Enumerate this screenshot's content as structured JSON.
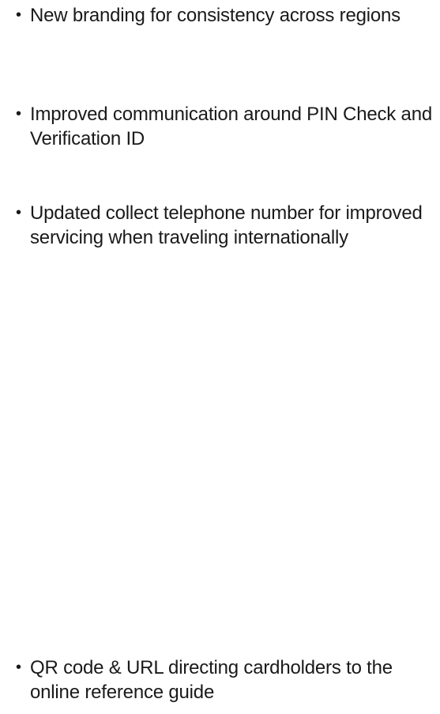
{
  "bullets": [
    {
      "marker": "•",
      "text": "New branding for consistency across regions"
    },
    {
      "marker": "•",
      "text": "Improved communication around PIN Check and Verification ID"
    },
    {
      "marker": "•",
      "text": "Updated collect telephone number for improved servicing when traveling internationally"
    },
    {
      "marker": "•",
      "text": "QR code & URL directing cardholders to the online reference guide"
    }
  ]
}
